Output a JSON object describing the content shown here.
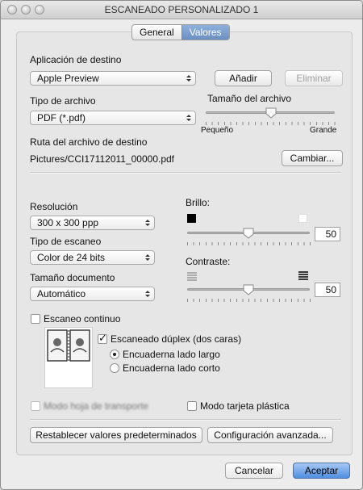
{
  "window": {
    "title": "ESCANEADO  PERSONALIZADO 1"
  },
  "tabs": [
    {
      "label": "General",
      "selected": false
    },
    {
      "label": "Valores",
      "selected": true
    }
  ],
  "destination": {
    "label": "Aplicación de destino",
    "app_value": "Apple Preview",
    "add_button": "Añadir",
    "remove_button": "Eliminar"
  },
  "file_type": {
    "label": "Tipo de archivo",
    "value": "PDF (*.pdf)"
  },
  "file_size": {
    "label": "Tamaño del archivo",
    "min_label": "Pequeño",
    "max_label": "Grande",
    "level_fraction": 0.5
  },
  "path": {
    "label": "Ruta del archivo de destino",
    "value": "Pictures/CCI17112011_00000.pdf",
    "change_button": "Cambiar..."
  },
  "resolution": {
    "label": "Resolución",
    "value": "300 x 300 ppp"
  },
  "scan_type": {
    "label": "Tipo de escaneo",
    "value": "Color de 24 bits"
  },
  "doc_size": {
    "label": "Tamaño documento",
    "value": "Automático"
  },
  "brightness": {
    "label": "Brillo:",
    "value": "50",
    "level_fraction": 0.5
  },
  "contrast": {
    "label": "Contraste:",
    "value": "50",
    "level_fraction": 0.5
  },
  "continuous": {
    "label": "Escaneo continuo",
    "checked": false
  },
  "duplex": {
    "label": "Escaneado dúplex (dos caras)",
    "checked": true,
    "options": [
      {
        "label": "Encuaderna lado largo",
        "selected": true
      },
      {
        "label": "Encuaderna lado corto",
        "selected": false
      }
    ]
  },
  "carrier_sheet": {
    "label": "Modo hoja de transporte",
    "checked": false,
    "enabled": false
  },
  "plastic_card": {
    "label": "Modo tarjeta plástica",
    "checked": false
  },
  "reset_button": "Restablecer valores predeterminados",
  "advanced_button": "Configuración avanzada...",
  "cancel_button": "Cancelar",
  "accept_button": "Aceptar",
  "colors": {
    "accent": "#4f8fe0",
    "panel": "#e6e6e6",
    "window": "#ececec"
  }
}
